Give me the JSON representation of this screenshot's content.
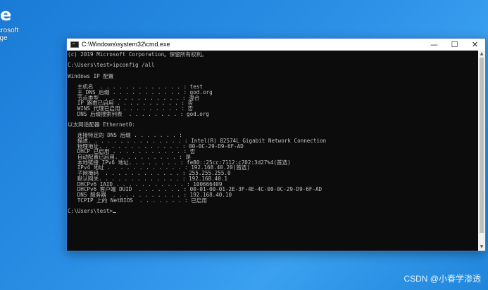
{
  "desktop": {
    "edge_icon_glyph": "e",
    "edge_label": "icrosoft\ndge"
  },
  "window": {
    "title": "C:\\Windows\\system32\\cmd.exe",
    "min_glyph": "—",
    "max_glyph": "☐",
    "close_glyph": "✕"
  },
  "console_lines": [
    "(c) 2019 Microsoft Corporation。保留所有权利。",
    "",
    "C:\\Users\\test>ipconfig /all",
    "",
    "Windows IP 配置",
    "",
    "   主机名  . . . . . . . . . . . . . : test",
    "   主 DNS 后缀 . . . . . . . . . . . : god.org",
    "   节点类型  . . . . . . . . . . . . : 混合",
    "   IP 路由已启用 . . . . . . . . . . : 否",
    "   WINS 代理已启用 . . . . . . . . . : 否",
    "   DNS 后缀搜索列表  . . . . . . . . : god.org",
    "",
    "以太网适配器 Ethernet0:",
    "",
    "   连接特定的 DNS 后缀 . . . . . . . :",
    "   描述. . . . . . . . . . . . . . . : Intel(R) 82574L Gigabit Network Connection",
    "   物理地址. . . . . . . . . . . . . : 00-0C-29-D9-6F-AD",
    "   DHCP 已启用 . . . . . . . . . . . : 否",
    "   自动配置已启用. . . . . . . . . . : 是",
    "   本地链接 IPv6 地址. . . . . . . . : fe80::25cc:7112:c702:3d27%4(首选)",
    "   IPv4 地址 . . . . . . . . . . . . : 192.168.40.20(首选)",
    "   子网掩码  . . . . . . . . . . . . : 255.255.255.0",
    "   默认网关. . . . . . . . . . . . . : 192.168.40.1",
    "   DHCPv6 IAID . . . . . . . . . . . : 100666409",
    "   DHCPv6 客户端 DUID  . . . . . . . : 00-01-00-01-2E-3F-4E-4C-00-0C-29-D9-6F-AD",
    "   DNS 服务器  . . . . . . . . . . . : 192.168.40.10",
    "   TCPIP 上的 NetBIOS  . . . . . . . : 已启用",
    ""
  ],
  "prompt": "C:\\Users\\test>",
  "watermark": "CSDN @小春学渗透"
}
